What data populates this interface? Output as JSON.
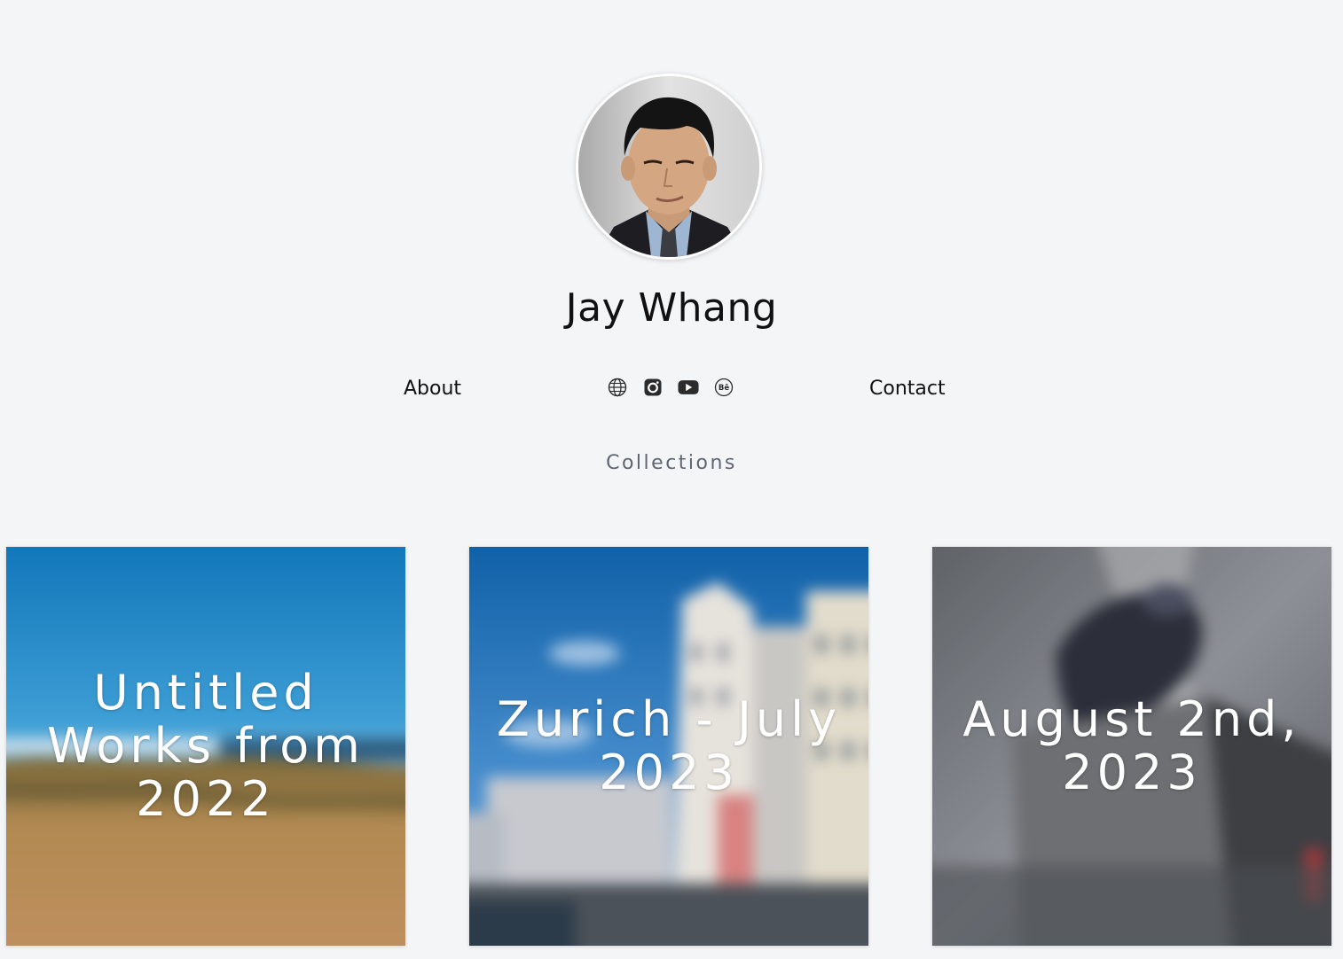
{
  "profile": {
    "name": "Jay Whang",
    "avatar_alt": "profile-photo"
  },
  "nav": {
    "about_label": "About",
    "contact_label": "Contact"
  },
  "socials": [
    {
      "icon": "globe-icon"
    },
    {
      "icon": "instagram-icon"
    },
    {
      "icon": "youtube-icon"
    },
    {
      "icon": "behance-icon",
      "text": "Bē"
    }
  ],
  "collections": {
    "heading": "Collections",
    "items": [
      {
        "title": "Untitled Works from 2022"
      },
      {
        "title": "Zurich - July 2023"
      },
      {
        "title": "August 2nd, 2023"
      }
    ]
  },
  "colors": {
    "background": "#f4f5f7",
    "heading_muted": "#5f6673",
    "text": "#111111"
  }
}
